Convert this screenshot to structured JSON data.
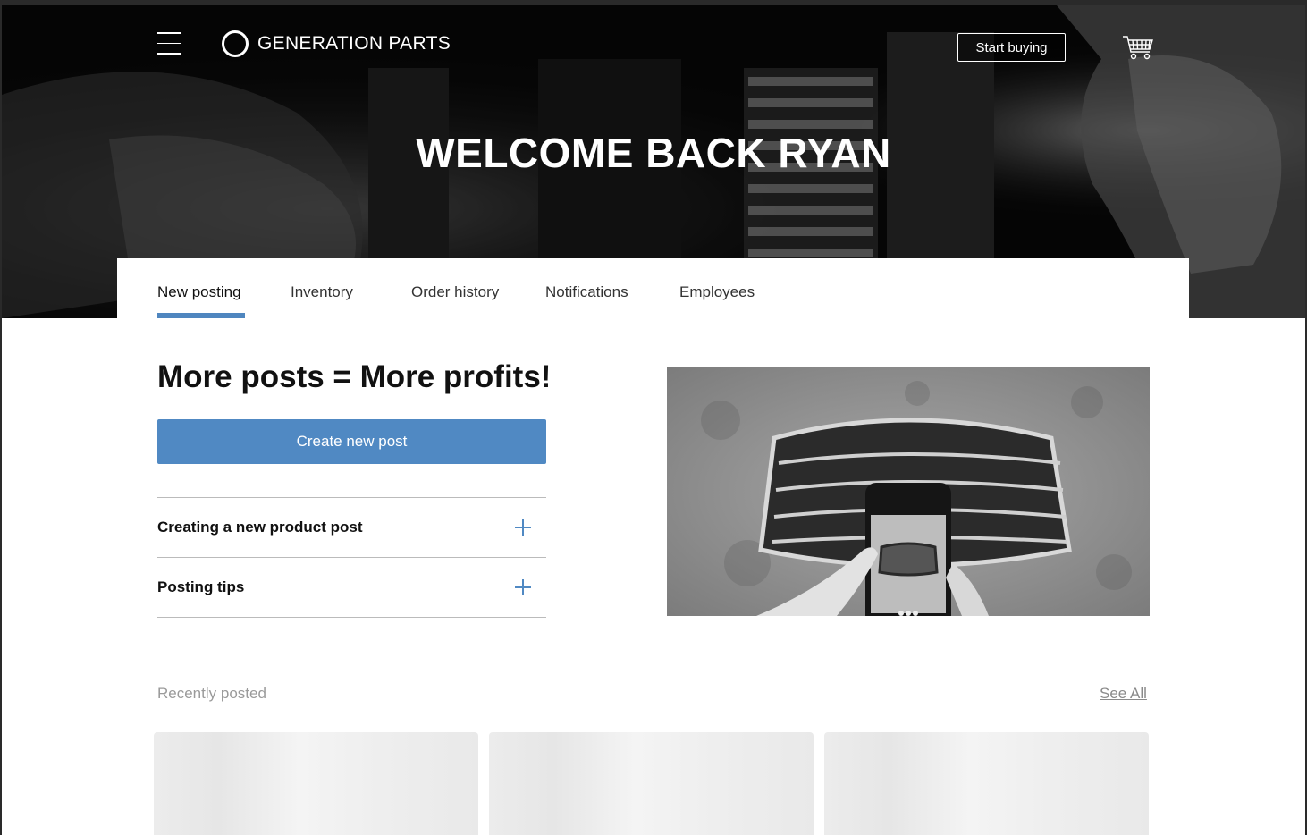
{
  "header": {
    "brand": "GENERATION PARTS",
    "start_buying_label": "Start buying",
    "welcome_title": "WELCOME BACK RYAN"
  },
  "tabs": [
    {
      "label": "New posting",
      "active": true
    },
    {
      "label": "Inventory",
      "active": false
    },
    {
      "label": "Order history",
      "active": false
    },
    {
      "label": "Notifications",
      "active": false
    },
    {
      "label": "Employees",
      "active": false
    }
  ],
  "main": {
    "headline": "More posts = More profits!",
    "create_button_label": "Create new post",
    "accordion": [
      {
        "label": "Creating a new product post"
      },
      {
        "label": "Posting tips"
      }
    ]
  },
  "recent": {
    "label": "Recently posted",
    "see_all_label": "See All"
  },
  "colors": {
    "accent": "#5089c3",
    "tab_underline": "#4f86bf",
    "hero_bg": "#0a0a0a"
  },
  "icons": {
    "menu": "hamburger-menu-icon",
    "logo": "ring-logo-icon",
    "cart": "shopping-cart-icon",
    "accordion": "plus-icon"
  }
}
